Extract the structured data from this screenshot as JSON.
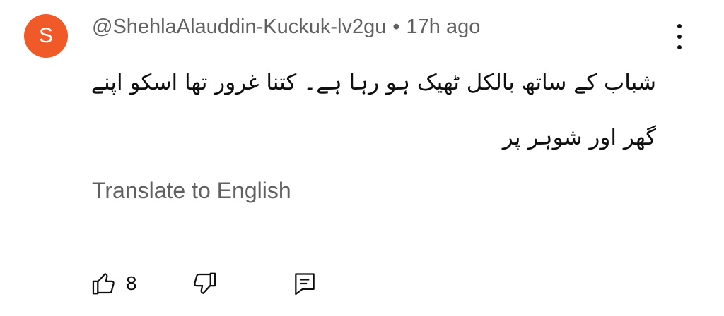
{
  "comment": {
    "avatar_letter": "S",
    "avatar_color": "#f05a28",
    "author": "@ShehlaAlauddin-Kuckuk-lv2gu",
    "separator": "•",
    "time": "17h ago",
    "text": "شباب کے ساتھ بالکل ٹھیک ہو رہا ہے۔ کتنا غرور تھا اسکو اپنے گھر اور شوہر پر",
    "translate_label": "Translate to English",
    "like_count": "8"
  },
  "icons": {
    "like": "thumbs-up-icon",
    "dislike": "thumbs-down-icon",
    "reply": "reply-comment-icon",
    "more": "more-vertical-icon"
  }
}
